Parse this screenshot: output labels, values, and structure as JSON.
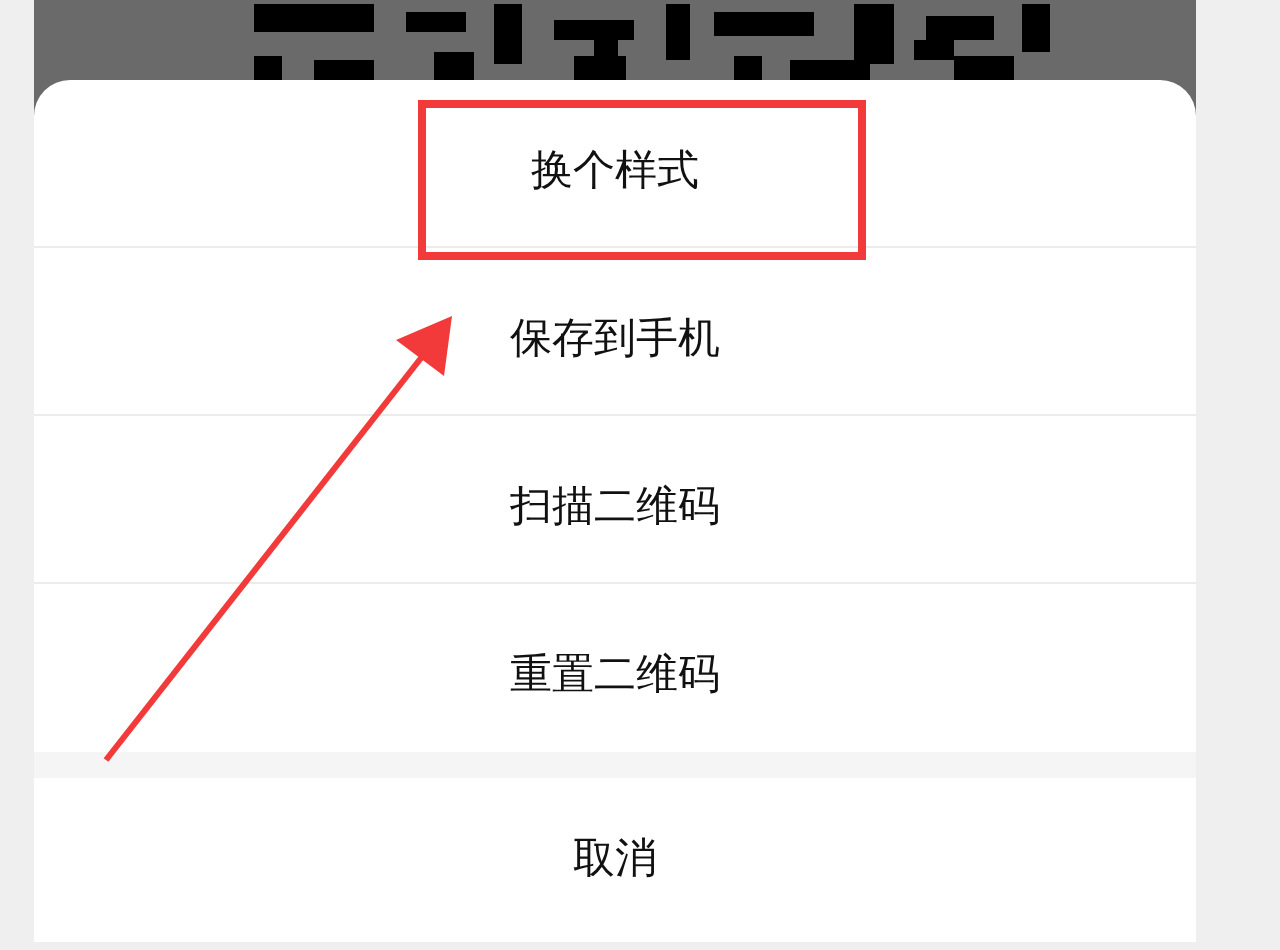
{
  "actions": [
    {
      "label": "换个样式",
      "highlighted": true
    },
    {
      "label": "保存到手机",
      "highlighted": false
    },
    {
      "label": "扫描二维码",
      "highlighted": false
    },
    {
      "label": "重置二维码",
      "highlighted": false
    }
  ],
  "cancel": "取消"
}
